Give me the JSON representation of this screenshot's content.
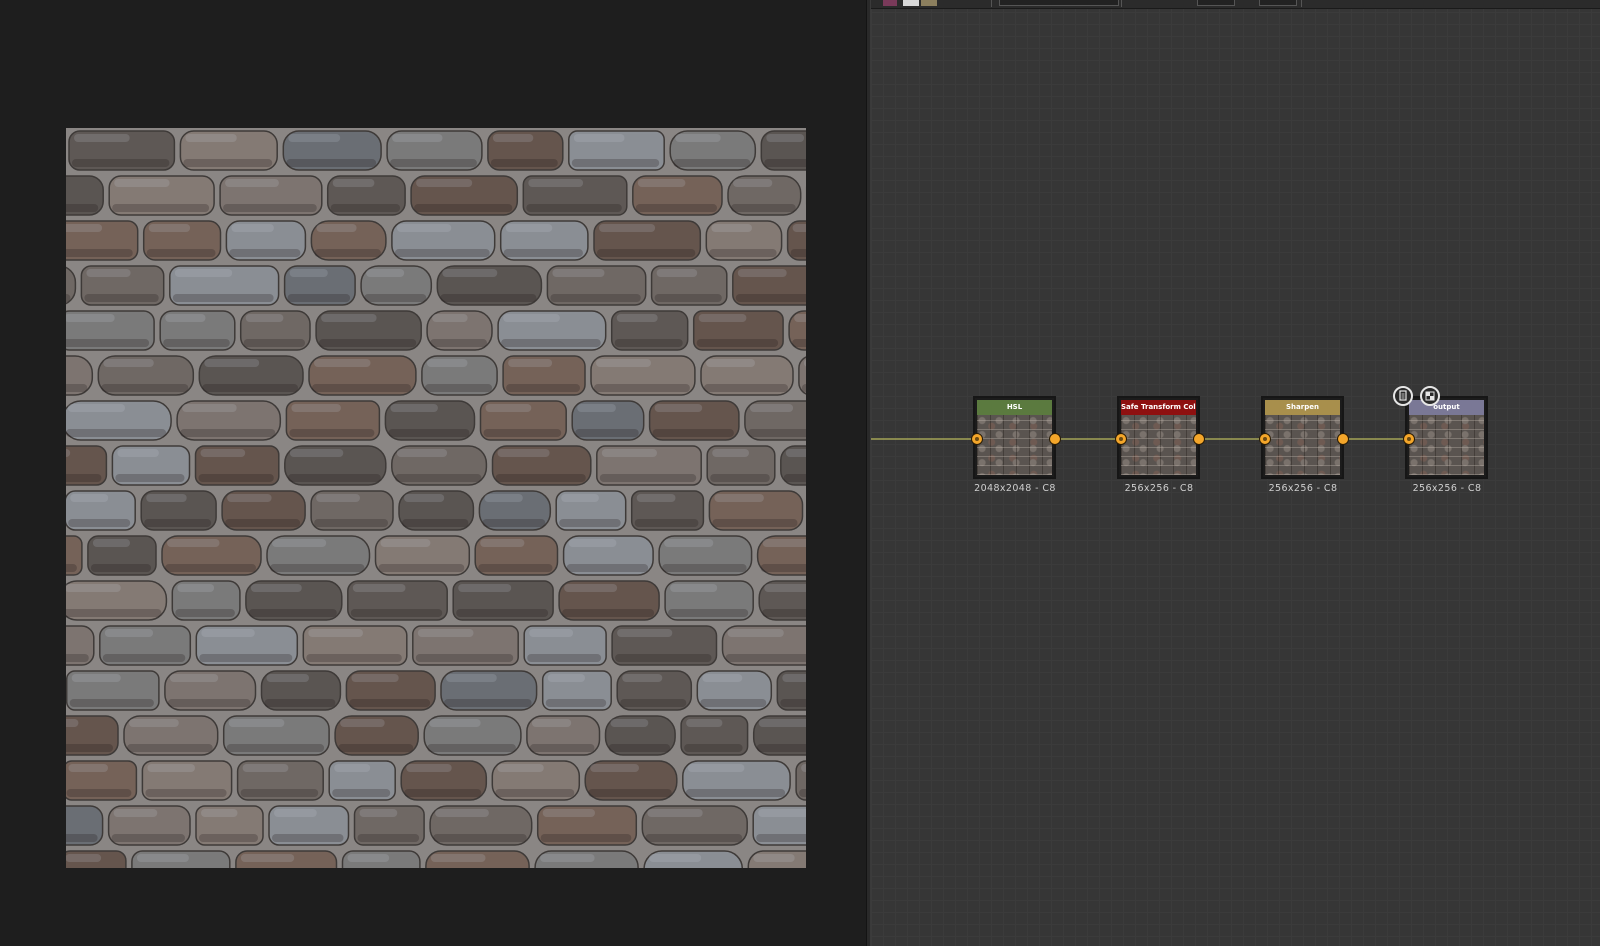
{
  "graph": {
    "nodes": [
      {
        "id": "hsl",
        "title": "HSL",
        "header_color": "#5b7a3f",
        "info": "2048x2048 - C8"
      },
      {
        "id": "safe-transform-color",
        "title": "Safe Transform Color",
        "header_color": "#8e1010",
        "info": "256x256 - C8"
      },
      {
        "id": "sharpen",
        "title": "Sharpen",
        "header_color": "#a88f4c",
        "info": "256x256 - C8"
      },
      {
        "id": "output",
        "title": "output",
        "header_color": "#7a7896",
        "info": "256x256 - C8"
      }
    ],
    "output_badges": [
      {
        "icon": "document-icon"
      },
      {
        "icon": "checker-icon"
      }
    ],
    "wire_color": "#b9b95c",
    "port_color": "#f4a62a"
  },
  "view2d": {
    "content": "stone-wall-texture"
  }
}
